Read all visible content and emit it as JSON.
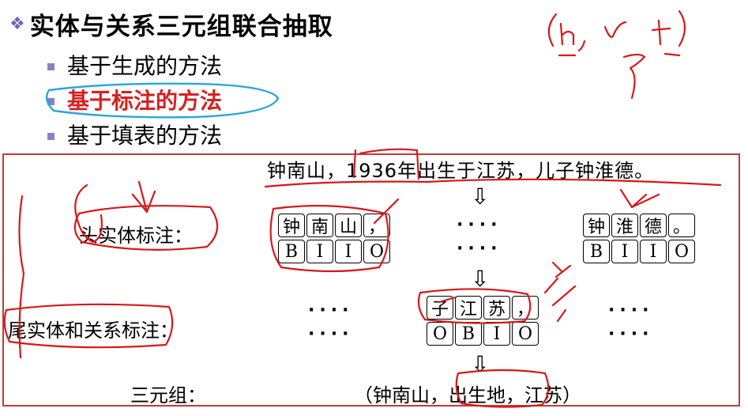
{
  "title": "实体与关系三元组联合抽取",
  "bullets": [
    {
      "text": "基于生成的方法",
      "active": false
    },
    {
      "text": "基于标注的方法",
      "active": true
    },
    {
      "text": "基于填表的方法",
      "active": false
    }
  ],
  "sentence": "钟南山，1936年出生于江苏，儿子钟淮德。",
  "labels": {
    "head": "头实体标注：",
    "tail": "尾实体和关系标注：",
    "triple": "三元组："
  },
  "groups": {
    "head_left": {
      "tokens": [
        "钟",
        "南",
        "山",
        "，"
      ],
      "tags": [
        "B",
        "I",
        "I",
        "O"
      ]
    },
    "head_right": {
      "tokens": [
        "钟",
        "淮",
        "德",
        "。"
      ],
      "tags": [
        "B",
        "I",
        "I",
        "O"
      ]
    },
    "tail_mid": {
      "tokens": [
        "子",
        "江",
        "苏",
        "，"
      ],
      "tags": [
        "O",
        "B",
        "I",
        "O"
      ]
    }
  },
  "dots": "····",
  "triple": "（钟南山，出生地，江苏）",
  "annotation_ink": "(h, r, t)",
  "colors": {
    "accent": "#d62020",
    "frame": "#c23a3a",
    "ink": "#d81818",
    "highlight": "#2aa7d8",
    "bullet": "#8a7fc9"
  }
}
